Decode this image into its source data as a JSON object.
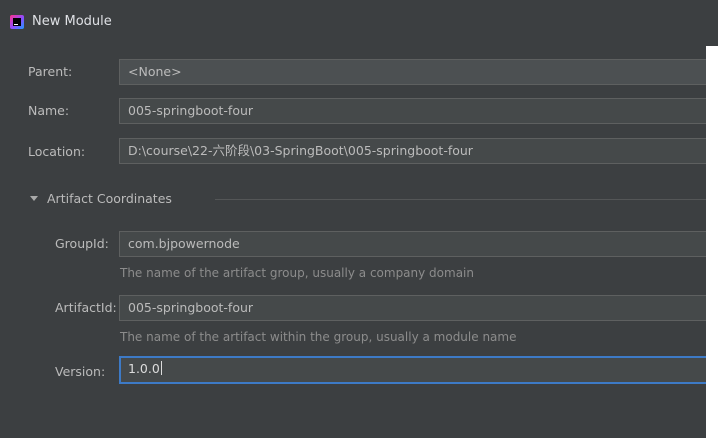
{
  "window": {
    "title": "New Module",
    "icon": "intellij-idea-icon"
  },
  "form": {
    "parent": {
      "label": "Parent:",
      "value": "<None>"
    },
    "name": {
      "label": "Name:",
      "value": "005-springboot-four"
    },
    "location": {
      "label": "Location:",
      "value": "D:\\course\\22-六阶段\\03-SpringBoot\\005-springboot-four"
    }
  },
  "artifact": {
    "section_label": "Artifact Coordinates",
    "expanded": true,
    "group_id": {
      "label": "GroupId:",
      "value": "com.bjpowernode",
      "hint": "The name of the artifact group, usually a company domain"
    },
    "artifact_id": {
      "label": "ArtifactId:",
      "value": "005-springboot-four",
      "hint": "The name of the artifact within the group, usually a module name"
    },
    "version": {
      "label": "Version:",
      "value": "1.0.0"
    }
  },
  "colors": {
    "background": "#3c3f41",
    "field_background": "#45494a",
    "focus_border": "#3d7ac6",
    "label_text": "#bbbbbb",
    "hint_text": "#8c8c8c"
  }
}
